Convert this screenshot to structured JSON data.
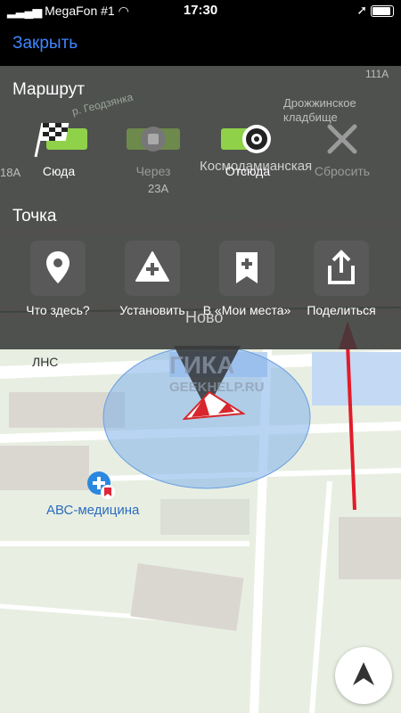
{
  "status_bar": {
    "carrier": "MegaFon #1",
    "time": "17:30",
    "icons": [
      "signal-icon",
      "wifi-icon",
      "location-arrow-icon",
      "battery-icon"
    ]
  },
  "top_bar": {
    "close_label": "Закрыть"
  },
  "route_section": {
    "title": "Маршрут",
    "items": [
      {
        "label": "Сюда",
        "icon": "checkered-flag-icon",
        "enabled": true
      },
      {
        "label": "Через",
        "icon": "via-point-icon",
        "enabled": false
      },
      {
        "label": "Отсюда",
        "icon": "start-point-icon",
        "enabled": true
      },
      {
        "label": "Сбросить",
        "icon": "close-icon",
        "enabled": false
      }
    ]
  },
  "point_section": {
    "title": "Точка",
    "items": [
      {
        "label": "Что здесь?",
        "icon": "map-pin-icon"
      },
      {
        "label": "Установить",
        "icon": "add-place-icon"
      },
      {
        "label": "В «Мои места»",
        "icon": "bookmark-add-icon"
      },
      {
        "label": "Поделиться",
        "icon": "share-icon"
      }
    ]
  },
  "map": {
    "labels": {
      "street_top": "р. Геодзянка",
      "cemetery": "Дрожжинское кладбище",
      "building_111a": "111А",
      "building_18a": "18А",
      "building_23a": "23А",
      "street_kosmo": "Космодамианская",
      "street_novo": "Ново",
      "lns": "ЛНС",
      "watermark_1": "ГИКА",
      "watermark_2": "GEEKHELP.RU",
      "clinic": "АВС-медицина"
    },
    "colors": {
      "accuracy_circle": "#7fb0ea",
      "annotation_arrow": "#e21b2a",
      "nav_arrow": "#d7262d"
    }
  },
  "locate_button": {
    "icon": "navigation-arrow-icon"
  }
}
